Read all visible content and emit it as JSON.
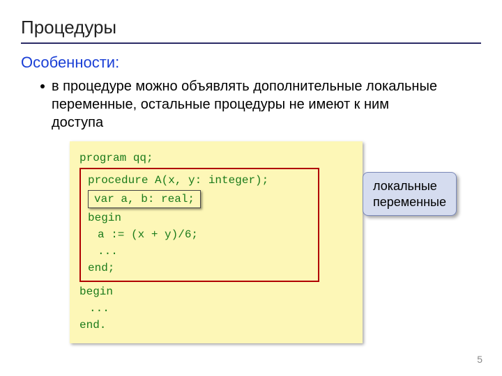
{
  "title": "Процедуры",
  "subtitle": "Особенности:",
  "bullet": "в процедуре можно объявлять дополнительные локальные переменные, остальные процедуры не имеют к ним доступа",
  "code": {
    "l1": "program qq;",
    "proc": {
      "l1": "procedure A(x, y: integer);",
      "var": "var a, b: real;",
      "l2": "begin",
      "l3": "a := (x + y)/6;",
      "l4": "...",
      "l5": "end;"
    },
    "l2": "begin",
    "l3": "...",
    "l4": "end."
  },
  "callout": {
    "line1": "локальные",
    "line2": "переменные"
  },
  "page": "5"
}
